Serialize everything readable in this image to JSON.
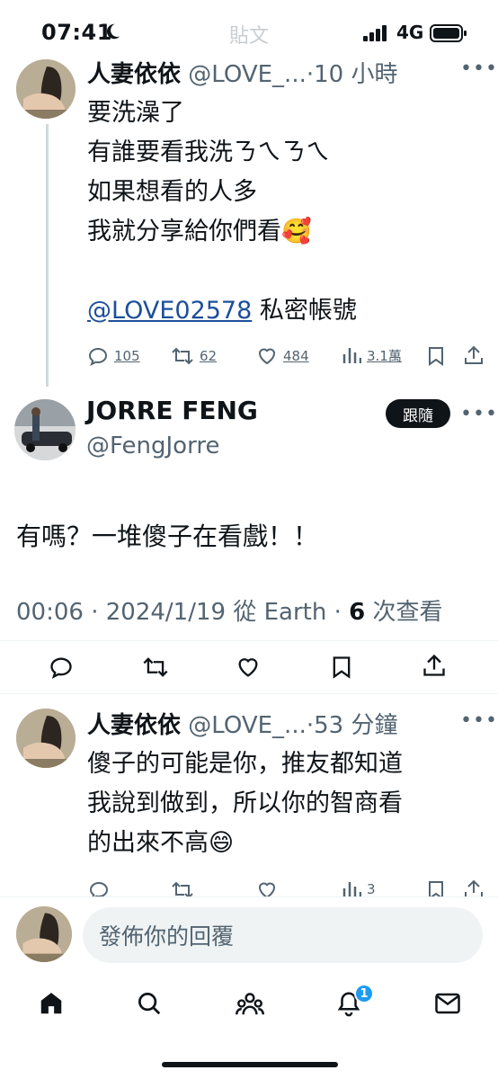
{
  "status_bar": {
    "time": "07:41",
    "network": "4G",
    "ghost_title": "貼文"
  },
  "tweet1": {
    "name": "人妻依依",
    "handle": "@LOVE_...",
    "time": "·10 小時",
    "lines": [
      "要洗澡了",
      "有誰要看我洗ㄋㄟㄋㄟ",
      "如果想看的人多",
      "我就分享給你們看🥰"
    ],
    "mention": "@LOVE02578",
    "mention_suffix": " 私密帳號",
    "replies": "105",
    "reposts": "62",
    "likes": "484",
    "views": "3.1萬"
  },
  "main_tweet": {
    "name": "JORRE FENG",
    "handle": "@FengJorre",
    "follow_label": "跟隨",
    "text": "有嗎？一堆傻子在看戲！！",
    "time": "00:06",
    "date": "2024/1/19",
    "source": "從 Earth",
    "views_count": "6",
    "views_label": "次查看"
  },
  "tweet3": {
    "name": "人妻依依",
    "handle": "@LOVE_...",
    "time": "·53 分鐘",
    "lines": [
      "傻子的可能是你，推友都知道",
      "我說到做到，所以你的智商看",
      "的出來不高😄"
    ],
    "views": "3"
  },
  "composer": {
    "placeholder": "發佈你的回覆"
  },
  "nav": {
    "notification_count": "1"
  },
  "colors": {
    "accent": "#1d9bf0",
    "text": "#0f1419",
    "secondary": "#536471"
  }
}
